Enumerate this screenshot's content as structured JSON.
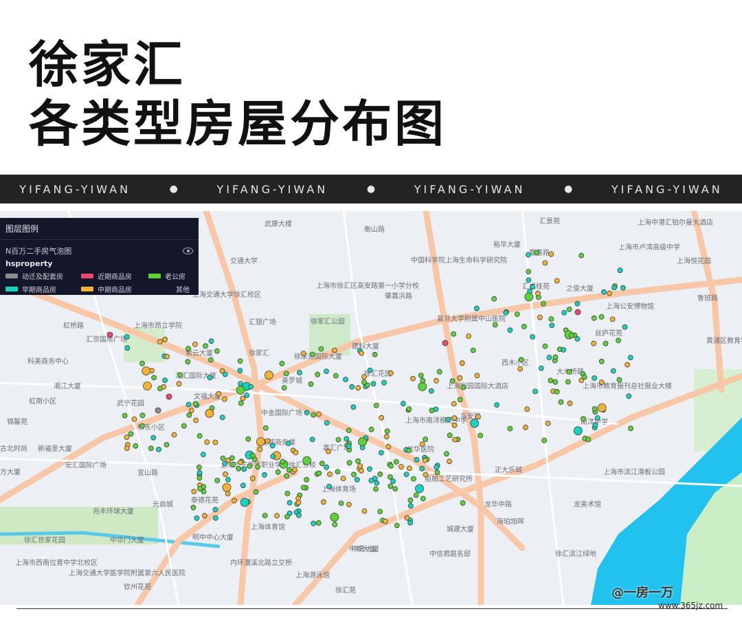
{
  "header": {
    "line1": "徐家汇",
    "line2": "各类型房屋分布图"
  },
  "band": {
    "text": "YIFANG-YIWAN",
    "sep": "●"
  },
  "legend": {
    "title": "图层图例",
    "layer": "N百万二手房气泡图",
    "field": "hsproperty",
    "items": [
      {
        "label": "动迁及配套房",
        "color": "#8c8c8c"
      },
      {
        "label": "近期商品房",
        "color": "#e84a72"
      },
      {
        "label": "老公房",
        "color": "#5fd23a"
      },
      {
        "label": "早期商品房",
        "color": "#19d3c0"
      },
      {
        "label": "中期商品房",
        "color": "#f2b233"
      },
      {
        "label": "其他",
        "color": ""
      }
    ]
  },
  "map_labels": [
    "武康大楼",
    "衡山路",
    "交通大学",
    "上海交通大学徐汇校区",
    "虹桥路",
    "上海市昂立学院",
    "汇京国际广场",
    "紫云大厦",
    "科美商务中心",
    "港汇国际大厦",
    "湘江大厦",
    "文福大厦",
    "虹南小区",
    "武宁花园",
    "锦馨苑",
    "桥东小区",
    "古北时尚",
    "新福圣大厦",
    "宏汇国际广场",
    "方大厦",
    "宜山路",
    "光启城",
    "泰德花苑",
    "兆丰环球大厦",
    "明中中心大厦",
    "徐汇世家花园",
    "中华门大厦",
    "上海市西南位育中学北校区",
    "上海交通大学医学院附属第六人民医院",
    "钦州花苑",
    "上海工艺美术职业学院徐汇分校",
    "上海体育馆",
    "内环漕溪北路立交桥",
    "上海游泳馆",
    "徐汇苑",
    "中金国际广场",
    "亚都商务楼",
    "美罗城",
    "汇银广场",
    "徐家汇",
    "徐家汇公园",
    "徐家汇国际大厦",
    "建科大厦",
    "徐汇花园",
    "嘉汇广场",
    "上海体育场",
    "中国科学院上海生命科学研究院",
    "上海市徐汇区高安路第一小学分校",
    "肇嘉浜路",
    "复旦大学附属中山医院",
    "西木小区",
    "上海利园国际大酒店",
    "上海市南洋模范中学",
    "东安路",
    "龙华医院",
    "船舶工艺研究所",
    "中环大厦",
    "汇景苑",
    "裕华大厦",
    "嘉善路",
    "汇成桂苑",
    "之俊大厦",
    "上海公安博物馆",
    "丝庐花苑",
    "大木桥路",
    "上海市教育报刊总社报业大楼",
    "南洋中学",
    "上海市卢湾高级中学",
    "上海中港汇铂尔曼大酒店",
    "上海悦花园",
    "鲁班路",
    "黄浦区教育学院附属中学",
    "正大乐城",
    "龙华中路",
    "海珀旭晖",
    "龙美术馆",
    "上海市滨江滑板公园",
    "城建大厦",
    "中信君庭名邸",
    "徐汇滨江绿地",
    "中城大厦"
  ],
  "watermark": {
    "handle": "@一房一万",
    "site": "www.365jz.com"
  }
}
